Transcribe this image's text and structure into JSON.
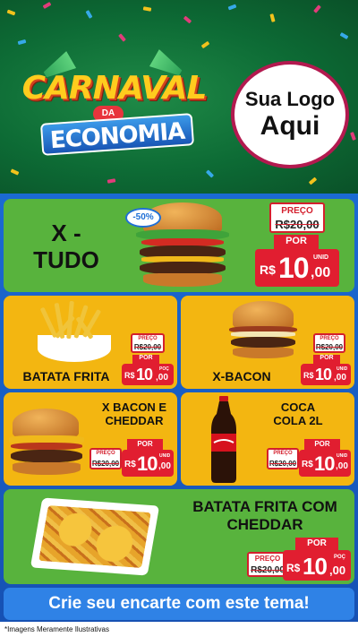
{
  "header": {
    "title_main": "CARNAVAL",
    "title_da": "DA",
    "title_sub": "ECONOMIA",
    "logo_line1": "Sua Logo",
    "logo_line2": "Aqui"
  },
  "products": [
    {
      "name": "X - TUDO",
      "discount": "-50%",
      "preco_label": "PREÇO",
      "old_price": "R$20,00",
      "por_label": "POR",
      "currency": "R$",
      "price_int": "10",
      "price_cents": ",00",
      "unit": "UNID"
    },
    {
      "name": "BATATA FRITA",
      "preco_label": "PREÇO",
      "old_price": "R$20,00",
      "por_label": "POR",
      "currency": "R$",
      "price_int": "10",
      "price_cents": ",00",
      "unit": "POÇ"
    },
    {
      "name": "X-BACON",
      "preco_label": "PREÇO",
      "old_price": "R$20,00",
      "por_label": "POR",
      "currency": "R$",
      "price_int": "10",
      "price_cents": ",00",
      "unit": "UNID"
    },
    {
      "name": "X BACON E CHEDDAR",
      "preco_label": "PREÇO",
      "old_price": "R$20,00",
      "por_label": "POR",
      "currency": "R$",
      "price_int": "10",
      "price_cents": ",00",
      "unit": "UNID"
    },
    {
      "name": "COCA COLA 2L",
      "preco_label": "PREÇO",
      "old_price": "R$20,00",
      "por_label": "POR",
      "currency": "R$",
      "price_int": "10",
      "price_cents": ",00",
      "unit": "UNID"
    },
    {
      "name": "BATATA FRITA COM CHEDDAR",
      "preco_label": "PREÇO",
      "old_price": "R$20,00",
      "por_label": "POR",
      "currency": "R$",
      "price_int": "10",
      "price_cents": ",00",
      "unit": "POÇ"
    }
  ],
  "cta": "Crie seu encarte com este tema!",
  "disclaimer": "*Imagens Meramente Ilustrativas",
  "colors": {
    "header_green": "#0d6b35",
    "panel_green": "#58b33d",
    "panel_yellow": "#f3b611",
    "price_red": "#e11e30",
    "background_blue": "#1b6ad3"
  }
}
